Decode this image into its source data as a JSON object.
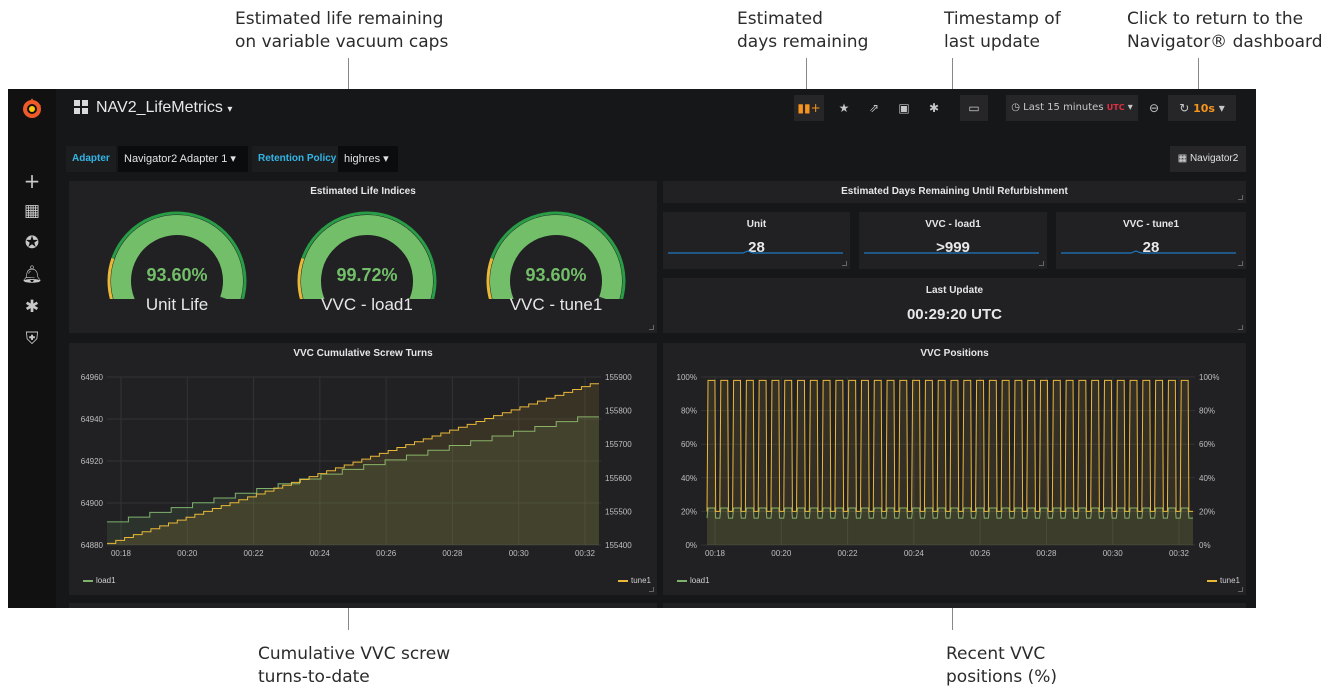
{
  "annotations": {
    "life_remaining": "Estimated life remaining\non variable vacuum caps",
    "days_remaining": "Estimated\ndays remaining",
    "timestamp": "Timestamp of\nlast update",
    "navigator_return": "Click to return to the\nNavigator® dashboard",
    "screw_turns": "Cumulative VVC screw\nturns-to-date",
    "recent_positions": "Recent VVC\npositions (%)"
  },
  "header": {
    "dashboard_title": "NAV2_LifeMetrics",
    "time_range": "Last 15 minutes",
    "timezone": "UTC",
    "refresh": "10s"
  },
  "variables": {
    "adapter_label": "Adapter",
    "adapter_value": "Navigator2 Adapter 1",
    "retention_label": "Retention Policy",
    "retention_value": "highres"
  },
  "nav_link": "Navigator2",
  "life_panel": {
    "title": "Estimated Life Indices",
    "gauges": [
      {
        "value": "93.60%",
        "label": "Unit Life",
        "fraction": 0.936
      },
      {
        "value": "99.72%",
        "label": "VVC - load1",
        "fraction": 0.9972
      },
      {
        "value": "93.60%",
        "label": "VVC - tune1",
        "fraction": 0.936
      }
    ]
  },
  "days_panel": {
    "title": "Estimated Days Remaining Until Refurbishment",
    "stats": [
      {
        "title": "Unit",
        "value": "28"
      },
      {
        "title": "VVC - load1",
        "value": ">999"
      },
      {
        "title": "VVC - tune1",
        "value": "28"
      }
    ]
  },
  "last_update": {
    "title": "Last Update",
    "value": "00:29:20 UTC"
  },
  "chart_data": [
    {
      "type": "line",
      "title": "VVC Cumulative Screw Turns",
      "x": [
        "00:18",
        "00:20",
        "00:22",
        "00:24",
        "00:26",
        "00:28",
        "00:30",
        "00:32"
      ],
      "left_ticks": [
        "64960",
        "64940",
        "64920",
        "64900",
        "64880"
      ],
      "right_ticks": [
        "155900",
        "155800",
        "155700",
        "155600",
        "155500",
        "155400"
      ],
      "ylim_left": [
        64880,
        64960
      ],
      "ylim_right": [
        155400,
        155900
      ],
      "series": [
        {
          "name": "load1",
          "axis": "left",
          "color": "#7eb26d",
          "start": 64891,
          "end": 64941,
          "steps": 22
        },
        {
          "name": "tune1",
          "axis": "right",
          "color": "#eab839",
          "start": 155405,
          "end": 155880,
          "steps": 55
        }
      ]
    },
    {
      "type": "line",
      "title": "VVC Positions",
      "x": [
        "00:18",
        "00:20",
        "00:22",
        "00:24",
        "00:26",
        "00:28",
        "00:30",
        "00:32"
      ],
      "left_ticks": [
        "100%",
        "80%",
        "60%",
        "40%",
        "20%",
        "0%"
      ],
      "right_ticks": [
        "100%",
        "80%",
        "60%",
        "40%",
        "20%",
        "0%"
      ],
      "ylim": [
        0,
        100
      ],
      "series": [
        {
          "name": "load1",
          "color": "#7eb26d",
          "high": 22,
          "low": 16,
          "cycles": 38
        },
        {
          "name": "tune1",
          "color": "#eab839",
          "high": 98,
          "low": 20,
          "cycles": 38
        }
      ]
    }
  ]
}
